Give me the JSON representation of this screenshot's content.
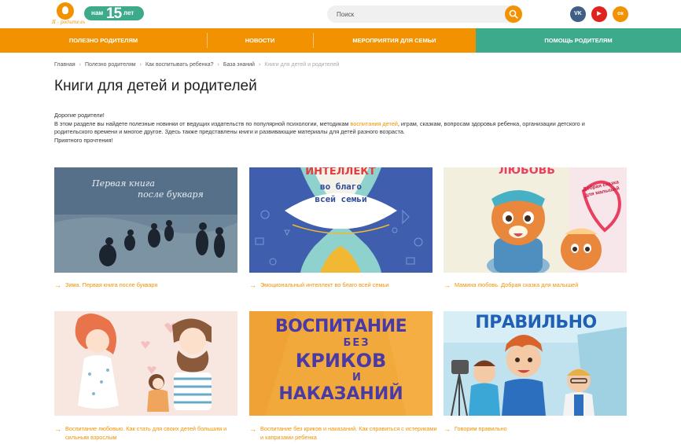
{
  "header": {
    "logo_text": "Я - родитель",
    "badge": {
      "prefix": "нам",
      "number": "15",
      "suffix": "лет"
    },
    "search_placeholder": "Поиск",
    "social": [
      "vk-icon",
      "youtube-icon",
      "odnoklassniki-icon"
    ],
    "social_labels": {
      "vk": "VK",
      "yt": "▶",
      "ok": "ок"
    }
  },
  "nav": {
    "items": [
      {
        "label": "ПОЛЕЗНО РОДИТЕЛЯМ"
      },
      {
        "label": "НОВОСТИ"
      },
      {
        "label": "МЕРОПРИЯТИЯ ДЛЯ СЕМЬИ"
      },
      {
        "label": "ПОМОЩЬ РОДИТЕЛЯМ"
      }
    ],
    "colors": {
      "primary": "#f39200",
      "secondary": "#3daa8c"
    }
  },
  "breadcrumb": [
    "Главная",
    "Полезно родителям",
    "Как воспитывать ребенка?",
    "База знаний",
    "Книги для детей и родителей"
  ],
  "page": {
    "title": "Книги для детей и родителей",
    "intro": {
      "greeting": "Дорогие родители!",
      "text_before_link": "В этом разделе вы найдете полезные новинки от ведущих издательств по популярной психологии, методикам ",
      "link": "воспитания детей",
      "text_after_link": ", играм, сказкам, вопросам здоровья ребенка, организации детского и родительского времени и многое другое. Здесь также представлены книги и развивающие материалы для детей разного возраста.",
      "closing": "Приятного прочтения!"
    }
  },
  "cards": [
    {
      "caption": "Зима. Первая книга после букваря",
      "cover_title_line1": "Первая книга",
      "cover_title_line2": "после букваря"
    },
    {
      "caption": "Эмоциональный интеллект во благо всей семьи",
      "cover_title_line1": "во благо",
      "cover_title_line2": "всей семьи"
    },
    {
      "caption": "Мамина любовь. Добрая сказка для малышей",
      "cover_title_line1": "Добрая сказка",
      "cover_title_line2": "для малышей"
    },
    {
      "caption": "Воспитание любовью. Как стать для своих детей большим и сильным взрослым"
    },
    {
      "caption": "Воспитание без криков и наказаний. Как справиться с истериками и капризами ребенка",
      "cover_title_line1": "ВОСПИТАНИЕ",
      "cover_title_line2": "БЕЗ",
      "cover_title_line3": "КРИКОВ",
      "cover_title_line4": "И",
      "cover_title_line5": "НАКАЗАНИЙ"
    },
    {
      "caption": "Говорим правильно",
      "cover_title_line1": "ПРАВИЛЬНО"
    }
  ],
  "arrow_glyph": "→"
}
